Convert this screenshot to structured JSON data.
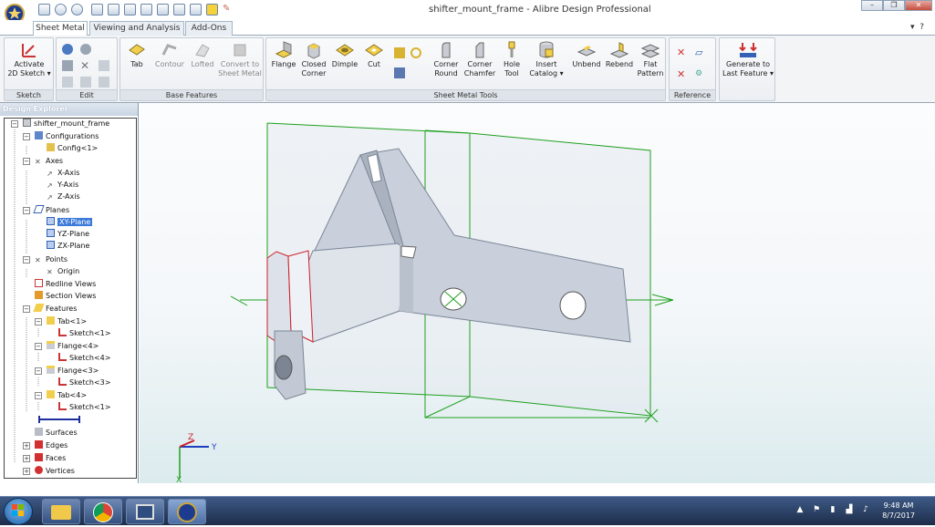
{
  "window": {
    "title": "shifter_mount_frame - Alibre Design Professional"
  },
  "tabs": [
    "Sheet Metal",
    "Viewing and Analysis",
    "Add-Ons"
  ],
  "ribbon": {
    "sketch": {
      "activate": "Activate",
      "sketch": "2D Sketch",
      "label": "Sketch"
    },
    "edit": {
      "label": "Edit"
    },
    "base": {
      "tab": "Tab",
      "contour": "Contour",
      "lofted": "Lofted",
      "convert1": "Convert to",
      "convert2": "Sheet Metal",
      "label": "Base Features"
    },
    "tools": {
      "flange": "Flange",
      "closed1": "Closed",
      "closed2": "Corner",
      "dimple": "Dimple",
      "cut": "Cut",
      "corner1": "Corner",
      "corner2": "Round",
      "cham1": "Corner",
      "cham2": "Chamfer",
      "hole1": "Hole",
      "hole2": "Tool",
      "insert1": "Insert",
      "insert2": "Catalog",
      "unbend": "Unbend",
      "rebend": "Rebend",
      "flat1": "Flat",
      "flat2": "Pattern",
      "label": "Sheet Metal Tools"
    },
    "reference": {
      "label": "Reference"
    },
    "generate": {
      "l1": "Generate to",
      "l2": "Last Feature"
    }
  },
  "explorer": {
    "header": "Design Explorer",
    "nodes": [
      {
        "t": "shifter_mount_frame"
      },
      {
        "t": "Configurations"
      },
      {
        "t": "Config<1>"
      },
      {
        "t": "Axes"
      },
      {
        "t": "X-Axis"
      },
      {
        "t": "Y-Axis"
      },
      {
        "t": "Z-Axis"
      },
      {
        "t": "Planes"
      },
      {
        "t": "XY-Plane"
      },
      {
        "t": "YZ-Plane"
      },
      {
        "t": "ZX-Plane"
      },
      {
        "t": "Points"
      },
      {
        "t": "Origin"
      },
      {
        "t": "Redline Views"
      },
      {
        "t": "Section Views"
      },
      {
        "t": "Features"
      },
      {
        "t": "Tab<1>"
      },
      {
        "t": "Sketch<1>"
      },
      {
        "t": "Flange<4>"
      },
      {
        "t": "Sketch<4>"
      },
      {
        "t": "Flange<3>"
      },
      {
        "t": "Sketch<3>"
      },
      {
        "t": "Tab<4>"
      },
      {
        "t": "Sketch<1>"
      },
      {
        "t": "Surfaces"
      },
      {
        "t": "Edges"
      },
      {
        "t": "Faces"
      },
      {
        "t": "Vertices"
      }
    ]
  },
  "axis": {
    "z": "Z",
    "y": "Y",
    "x": "X"
  },
  "clock": {
    "time": "9:48 AM",
    "date": "8/7/2017"
  },
  "colors": {
    "accent": "#3b7ad9",
    "planeGreen": "#1ea01e",
    "partRed": "#cc1f2a"
  }
}
